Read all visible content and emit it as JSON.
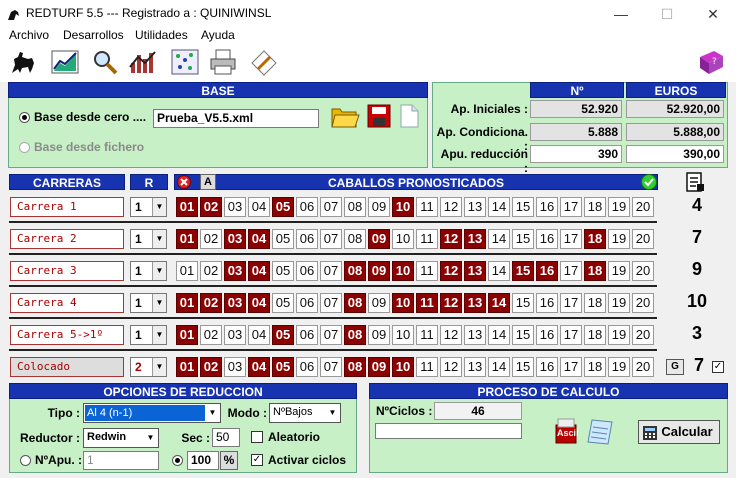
{
  "window": {
    "title": "REDTURF 5.5 --- Registrado a : QUINIWINSL",
    "min": "—",
    "max": "☐",
    "close": "✕"
  },
  "menu": [
    "Archivo",
    "Desarrollos",
    "Utilidades",
    "Ayuda"
  ],
  "base": {
    "header": "BASE",
    "option1": "Base desde cero ....",
    "option2": "Base desde fichero",
    "filename": "Prueba_V5.5.xml"
  },
  "stats": {
    "col_n": "Nº",
    "col_euros": "EUROS",
    "rows": [
      {
        "label": "Ap. Iniciales :",
        "n": "52.920",
        "euros": "52.920,00"
      },
      {
        "label": "Ap. Condiciona. :",
        "n": "5.888",
        "euros": "5.888,00"
      },
      {
        "label": "Apu. reducción :",
        "n": "390",
        "euros": "390,00"
      }
    ]
  },
  "grid": {
    "col_carreras": "CARRERAS",
    "col_r": "R",
    "col_caballos": "CABALLOS PRONOSTICADOS",
    "a_label": "A",
    "races": [
      {
        "name": "Carrera 1",
        "r": "1",
        "count": "4",
        "sel": [
          1,
          2,
          5,
          10
        ]
      },
      {
        "name": "Carrera 2",
        "r": "1",
        "count": "7",
        "sel": [
          1,
          3,
          4,
          9,
          12,
          13,
          18
        ]
      },
      {
        "name": "Carrera 3",
        "r": "1",
        "count": "9",
        "sel": [
          3,
          4,
          8,
          9,
          10,
          12,
          13,
          15,
          16,
          18
        ]
      },
      {
        "name": "Carrera 4",
        "r": "1",
        "count": "10",
        "sel": [
          1,
          2,
          3,
          4,
          8,
          10,
          11,
          12,
          13,
          14
        ]
      },
      {
        "name": "Carrera 5->1º",
        "r": "1",
        "count": "3",
        "sel": [
          1,
          5,
          8
        ]
      },
      {
        "name": "Colocado",
        "r": "2",
        "count": "7",
        "sel": [
          1,
          2,
          4,
          5,
          8,
          9,
          10
        ]
      }
    ],
    "g_label": "G"
  },
  "reduccion": {
    "header": "OPCIONES DE REDUCCION",
    "tipo_label": "Tipo :",
    "tipo_value": "Al 4 (n-1)",
    "modo_label": "Modo :",
    "modo_value": "NºBajos",
    "reductor_label": "Reductor :",
    "reductor_value": "Redwin",
    "sec_label": "Sec :",
    "sec_value": "50",
    "aleatorio_label": "Aleatorio",
    "napu_label": "NºApu. :",
    "napu_value": "1",
    "pct_value": "100",
    "pct_label": "%",
    "activar_label": "Activar ciclos"
  },
  "calculo": {
    "header": "PROCESO DE CALCULO",
    "nciclos_label": "NºCiclos :",
    "nciclos_value": "46",
    "calcular_label": "Calcular",
    "ascii_label": "Ascii"
  },
  "colors": {
    "accent": "#1733b0",
    "panel": "#c7f0c7",
    "selected": "#8b0000"
  }
}
